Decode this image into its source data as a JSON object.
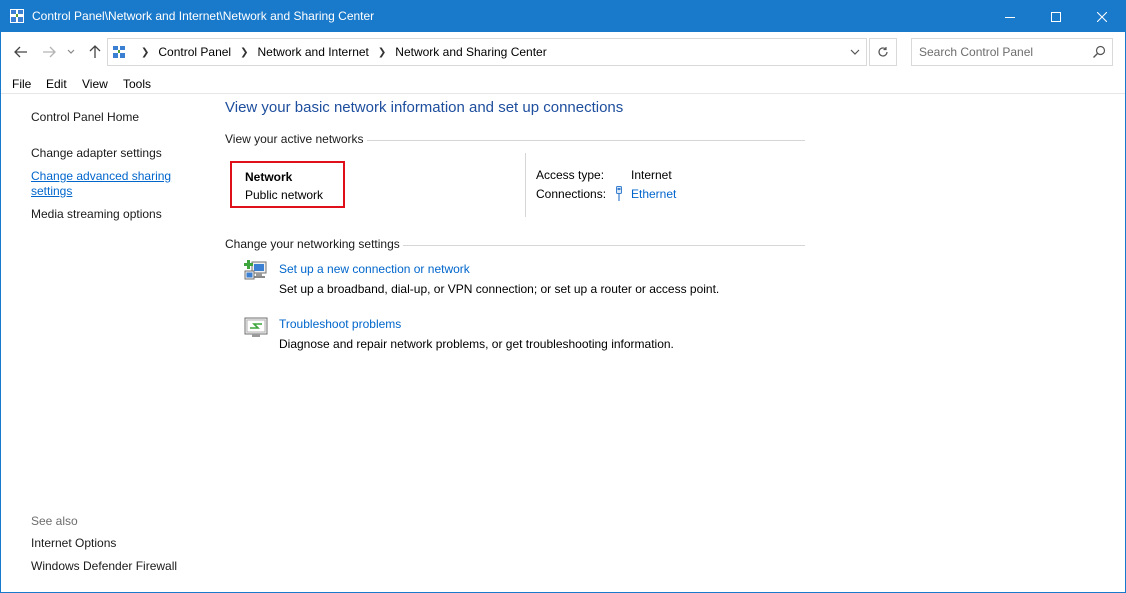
{
  "window": {
    "title": "Control Panel\\Network and Internet\\Network and Sharing Center",
    "accent_color": "#1979ca"
  },
  "nav": {
    "back_icon": "arrow-left-icon",
    "forward_icon": "arrow-right-icon",
    "recent_icon": "chevron-down-icon",
    "up_icon": "arrow-up-icon",
    "breadcrumbs": [
      "Control Panel",
      "Network and Internet",
      "Network and Sharing Center"
    ],
    "search_placeholder": "Search Control Panel"
  },
  "menu": [
    "File",
    "Edit",
    "View",
    "Tools"
  ],
  "left_pane": {
    "home": "Control Panel Home",
    "links": [
      "Change adapter settings",
      "Change advanced sharing settings",
      "Media streaming options"
    ],
    "see_also_label": "See also",
    "see_also": [
      "Internet Options",
      "Windows Defender Firewall"
    ]
  },
  "main": {
    "title": "View your basic network information and set up connections",
    "active_networks_heading": "View your active networks",
    "network": {
      "name": "Network",
      "type": "Public network",
      "access_type_label": "Access type:",
      "access_type_value": "Internet",
      "connections_label": "Connections:",
      "connection_value": "Ethernet",
      "highlight_color": "#e0101a"
    },
    "settings_heading": "Change your networking settings",
    "tasks": [
      {
        "link": "Set up a new connection or network",
        "description": "Set up a broadband, dial-up, or VPN connection; or set up a router or access point.",
        "icon": "new-connection-icon"
      },
      {
        "link": "Troubleshoot problems",
        "description": "Diagnose and repair network problems, or get troubleshooting information.",
        "icon": "troubleshoot-icon"
      }
    ]
  }
}
